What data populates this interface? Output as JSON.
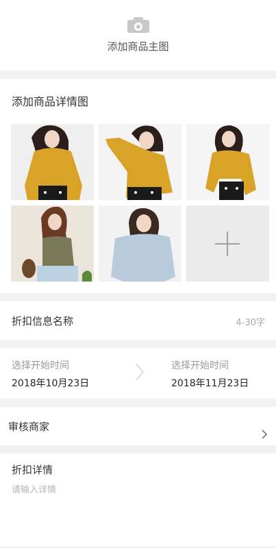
{
  "main_image": {
    "label": "添加商品主图",
    "icon": "camera-icon"
  },
  "detail_images": {
    "title": "添加商品详情图",
    "colors": {
      "mustard": "#D8A326",
      "olive": "#7A7A5A",
      "light_blue": "#B9CADD"
    },
    "add_icon": "plus-icon"
  },
  "discount_name": {
    "label": "折扣信息名称",
    "hint": "4-30字"
  },
  "dates": {
    "start_label": "选择开始时间",
    "start_value": "2018年10月23日",
    "end_label": "选择开始时间",
    "end_value": "2018年11月23日",
    "arrow_icon": "chevron-right-icon"
  },
  "merchant": {
    "label": "审核商家",
    "icon": "chevron-right-icon"
  },
  "details": {
    "label": "折扣详情",
    "placeholder": "请输入详情"
  }
}
